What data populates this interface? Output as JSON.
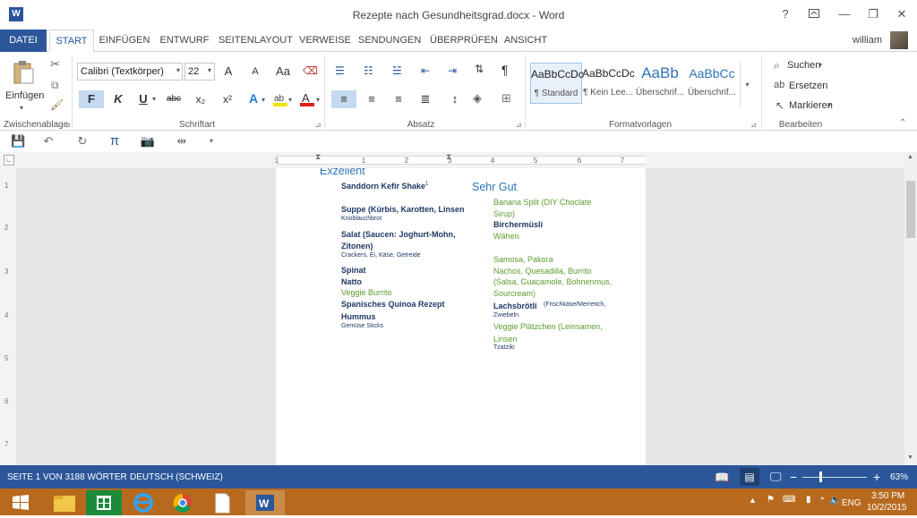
{
  "window": {
    "title": "Rezepte nach Gesundheitsgrad.docx - Word",
    "help": "?"
  },
  "tabs": [
    "DATEI",
    "START",
    "EINFÜGEN",
    "ENTWURF",
    "SEITENLAYOUT",
    "VERWEISE",
    "SENDUNGEN",
    "ÜBERPRÜFEN",
    "ANSICHT"
  ],
  "user": "william",
  "ribbon": {
    "clipboard": {
      "paste_label": "Einfügen",
      "group_label": "Zwischenablage"
    },
    "font": {
      "font_name": "Calibri (Textkörper)",
      "font_size": "22",
      "bold": "F",
      "italic": "K",
      "underline": "U",
      "strike": "abc",
      "sub": "x₂",
      "sup": "x²",
      "grow": "A",
      "shrink": "A",
      "case": "Aa",
      "group_label": "Schriftart"
    },
    "paragraph": {
      "group_label": "Absatz",
      "pilcrow": "¶"
    },
    "styles": {
      "items": [
        {
          "preview": "AaBbCcDc",
          "name": "¶ Standard"
        },
        {
          "preview": "AaBbCcDc",
          "name": "¶ Kein Lee..."
        },
        {
          "preview": "AaBb",
          "name": "Überschrif..."
        },
        {
          "preview": "AaBbCc",
          "name": "Überschrif..."
        }
      ],
      "group_label": "Formatvorlagen"
    },
    "editing": {
      "find": "Suchen",
      "replace": "Ersetzen",
      "select": "Markieren",
      "group_label": "Bearbeiten"
    }
  },
  "ruler": {
    "numbers": [
      "1",
      "1",
      "2",
      "3",
      "4",
      "5",
      "6",
      "7"
    ],
    "vnumbers": [
      "1",
      "2",
      "3",
      "4",
      "5",
      "6",
      "7"
    ]
  },
  "document": {
    "col1_heading": "Exzellent",
    "col1": [
      {
        "text": "Sanddorn Kefir Shake",
        "sup": "1",
        "style": "bl"
      },
      {
        "text": "Suppe (Kürbis, Karotten, Linsen",
        "style": "bl"
      },
      {
        "text": "Knoblauchbrot",
        "style": "sm"
      },
      {
        "text": "Salat (Saucen: Joghurt-Mohn,",
        "style": "bl"
      },
      {
        "text": "Zitonen)",
        "style": "bl"
      },
      {
        "text": "Crackers, Ei, Käse, Getreide",
        "style": "sm"
      },
      {
        "text": "Spinat",
        "style": "bl"
      },
      {
        "text": "Natto",
        "style": "bl"
      },
      {
        "text": "Veggie Burrito",
        "style": "gr"
      },
      {
        "text": "Spanisches Quinoa Rezept",
        "style": "bl"
      },
      {
        "text": "Hummus",
        "style": "bl"
      },
      {
        "text": "Gemüse Sticks",
        "style": "sm"
      }
    ],
    "col2_heading": "Sehr Gut",
    "col2": [
      {
        "text": "Banana Split (DIY Choclate",
        "style": "gr"
      },
      {
        "text": "Sirup)",
        "style": "gr"
      },
      {
        "text": "Birchermüsli",
        "style": "bl"
      },
      {
        "text": "Wähen",
        "style": "gr"
      },
      {
        "text": "Samosa, Pakora",
        "style": "gr"
      },
      {
        "text": "Nachos, Quesadilla, Burrito",
        "style": "gr"
      },
      {
        "text": "(Salsa, Guacamole, Bohnenmus,",
        "style": "gr"
      },
      {
        "text": "Sourcream)",
        "style": "gr"
      },
      {
        "text": "Lachsbrötli",
        "style": "bl"
      },
      {
        "text": "(Frischkäse/Merretich,",
        "style": "sm"
      },
      {
        "text": "Zwiebeln",
        "style": "sm"
      },
      {
        "text": "Veggie Plätzchen (Leinsamen,",
        "style": "gr"
      },
      {
        "text": "Linsen",
        "style": "gr"
      },
      {
        "text": "Tzatziki",
        "style": "sm"
      }
    ]
  },
  "status": {
    "page": "SEITE 1 VON 3",
    "words": "188 WÖRTER",
    "language": "DEUTSCH (SCHWEIZ)",
    "zoom": "63%",
    "minus": "−",
    "plus": "+"
  },
  "taskbar": {
    "lang": "ENG",
    "time": "3:50 PM",
    "date": "10/2/2015"
  },
  "colors": {
    "accent": "#2b579a",
    "heading": "#2e74b5",
    "green_text": "#5b9b2f",
    "taskbar": "#b76a1e"
  }
}
